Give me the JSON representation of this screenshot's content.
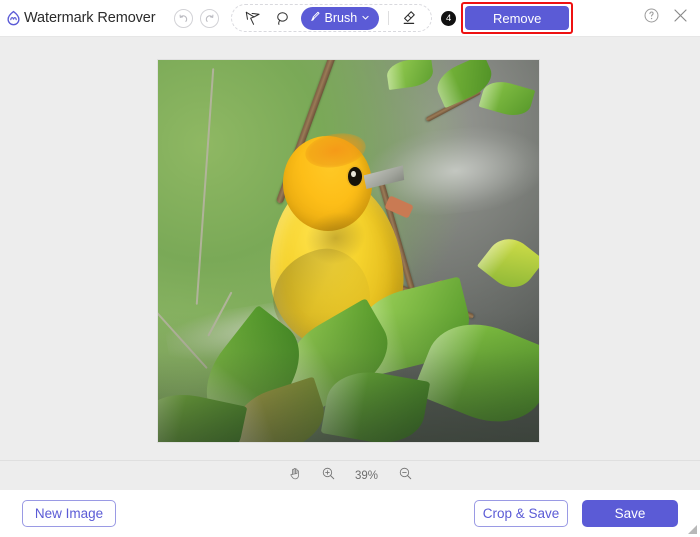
{
  "app": {
    "title": "Watermark Remover",
    "logo_icon": "watermark-remover-logo"
  },
  "header": {
    "undo_icon": "undo-icon",
    "redo_icon": "redo-icon",
    "tools": [
      {
        "icon": "lasso-polygon-icon",
        "name": "polygonal-lasso-tool"
      },
      {
        "icon": "lasso-freehand-icon",
        "name": "freehand-lasso-tool"
      }
    ],
    "brush": {
      "label": "Brush",
      "icon": "brush-icon",
      "chevron": "chevron-down-icon",
      "active": true
    },
    "eraser_icon": "eraser-icon",
    "step_badge": "4",
    "remove_label": "Remove",
    "highlight_color": "#ee1111",
    "accent_color": "#5b5bd6",
    "help_icon": "help-circle-icon",
    "close_icon": "close-icon"
  },
  "canvas": {
    "image_alt": "yellow weaver bird perched on a branch with green leaves"
  },
  "zoombar": {
    "pan_icon": "hand-pan-icon",
    "zoom_in_icon": "zoom-in-icon",
    "zoom_out_icon": "zoom-out-icon",
    "zoom_level": "39%"
  },
  "footer": {
    "new_image_label": "New Image",
    "crop_save_label": "Crop & Save",
    "save_label": "Save"
  }
}
